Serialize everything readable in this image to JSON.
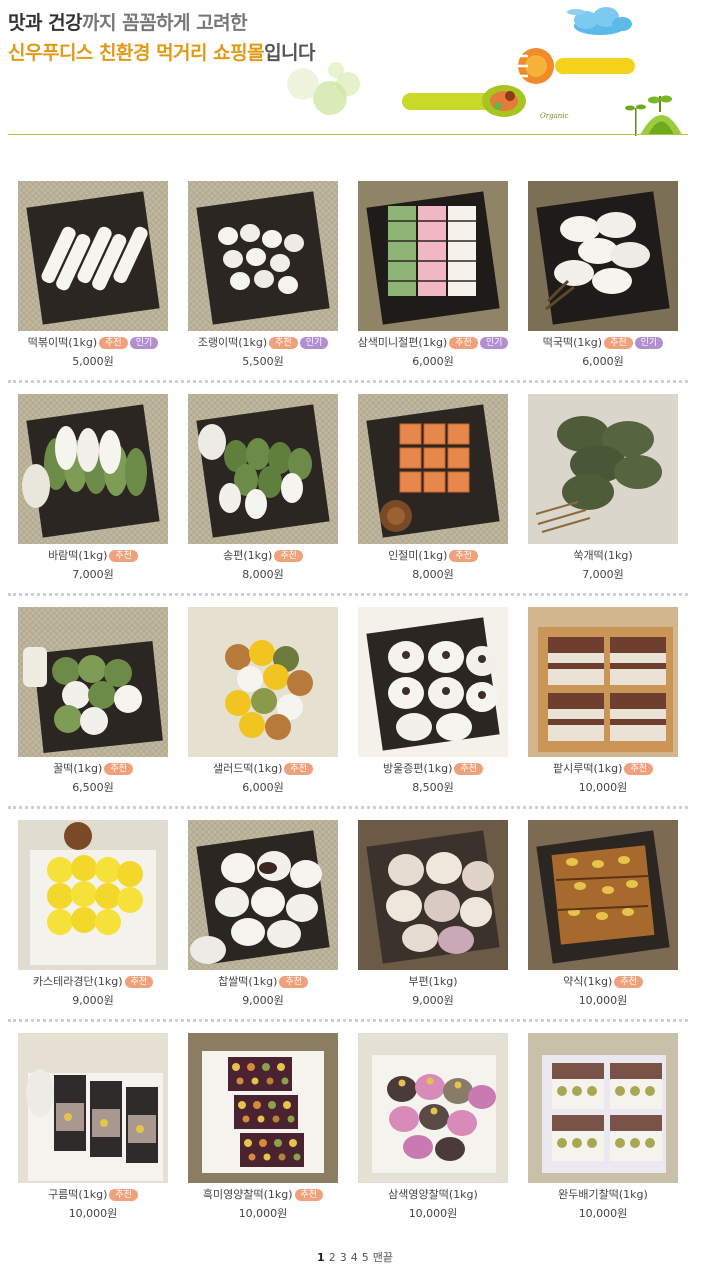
{
  "banner": {
    "line1_part1": "맛과 건강",
    "line1_part2": "까지 꼼꼼하게 고려한",
    "line2_part1": "신우푸디스 친환경 먹거리 쇼핑몰",
    "line2_part2": "입니다",
    "organic_label": "Organic",
    "colors": {
      "highlight": "#e29a16",
      "line": "#a9c64a",
      "spoon": "#c8d92a",
      "fork": "#f1c40f"
    }
  },
  "badges": {
    "recommended": "추천",
    "popular": "인기"
  },
  "products": [
    {
      "name": "떡볶이떡(1kg)",
      "price": "5,000원",
      "badges": [
        "recommended",
        "popular"
      ],
      "image": "white-rice-sticks"
    },
    {
      "name": "조랭이떡(1kg)",
      "price": "5,500원",
      "badges": [
        "recommended",
        "popular"
      ],
      "image": "white-joraengi"
    },
    {
      "name": "삼색미니절편(1kg)",
      "price": "6,000원",
      "badges": [
        "recommended",
        "popular"
      ],
      "image": "tricolor-jeolpyeon"
    },
    {
      "name": "떡국떡(1kg)",
      "price": "6,000원",
      "badges": [
        "recommended",
        "popular"
      ],
      "image": "sliced-rice-cake"
    },
    {
      "name": "바람떡(1kg)",
      "price": "7,000원",
      "badges": [
        "recommended"
      ],
      "image": "green-white-baram"
    },
    {
      "name": "송편(1kg)",
      "price": "8,000원",
      "badges": [
        "recommended"
      ],
      "image": "songpyeon"
    },
    {
      "name": "인절미(1kg)",
      "price": "8,000원",
      "badges": [
        "recommended"
      ],
      "image": "injeolmi"
    },
    {
      "name": "쑥개떡(1kg)",
      "price": "7,000원",
      "badges": [],
      "image": "ssukgae"
    },
    {
      "name": "꿀떡(1kg)",
      "price": "6,500원",
      "badges": [
        "recommended"
      ],
      "image": "kkultteok"
    },
    {
      "name": "샐러드떡(1kg)",
      "price": "6,000원",
      "badges": [
        "recommended"
      ],
      "image": "salad-tteok"
    },
    {
      "name": "방울증편(1kg)",
      "price": "8,500원",
      "badges": [
        "recommended"
      ],
      "image": "jeungpyeon"
    },
    {
      "name": "팥시루떡(1kg)",
      "price": "10,000원",
      "badges": [
        "recommended"
      ],
      "image": "sirutteok"
    },
    {
      "name": "카스테라경단(1kg)",
      "price": "9,000원",
      "badges": [
        "recommended"
      ],
      "image": "castella-gyeongdan"
    },
    {
      "name": "찹쌀떡(1kg)",
      "price": "9,000원",
      "badges": [
        "recommended"
      ],
      "image": "chapssaltteok"
    },
    {
      "name": "부편(1kg)",
      "price": "9,000원",
      "badges": [],
      "image": "bupyeon"
    },
    {
      "name": "약식(1kg)",
      "price": "10,000원",
      "badges": [
        "recommended"
      ],
      "image": "yaksik"
    },
    {
      "name": "구름떡(1kg)",
      "price": "10,000원",
      "badges": [
        "recommended"
      ],
      "image": "gureumtteok"
    },
    {
      "name": "흑미영양찰떡(1kg)",
      "price": "10,000원",
      "badges": [
        "recommended"
      ],
      "image": "black-rice-chaltteok"
    },
    {
      "name": "삼색영양찰떡(1kg)",
      "price": "10,000원",
      "badges": [],
      "image": "tricolor-chaltteok"
    },
    {
      "name": "완두배기찰떡(1kg)",
      "price": "10,000원",
      "badges": [],
      "image": "pea-chaltteok"
    }
  ],
  "pagination": {
    "pages": [
      "1",
      "2",
      "3",
      "4",
      "5"
    ],
    "current": "1",
    "last_label": "맨끝"
  }
}
